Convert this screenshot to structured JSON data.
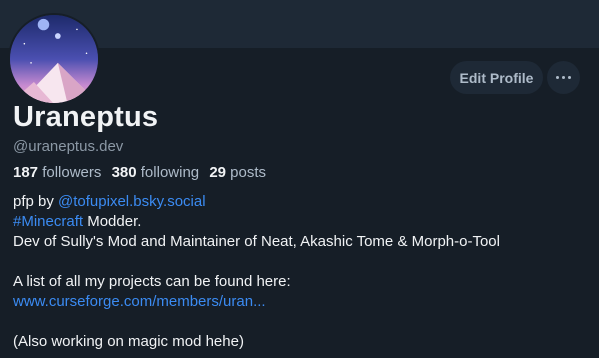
{
  "profile": {
    "display_name": "Uraneptus",
    "handle": "@uraneptus.dev",
    "avatar_icon": "space-landscape-avatar"
  },
  "actions": {
    "edit_label": "Edit Profile",
    "more_icon": "ellipsis-icon"
  },
  "stats": {
    "followers_count": "187",
    "followers_label": "followers",
    "following_count": "380",
    "following_label": "following",
    "posts_count": "29",
    "posts_label": "posts"
  },
  "bio": {
    "line1_prefix": "pfp by ",
    "line1_mention": "@tofupixel.bsky.social",
    "line2_hashtag": "#Minecraft",
    "line2_rest": " Modder.",
    "line3": "Dev of Sully's Mod and Maintainer of Neat, Akashic Tome & Morph-o-Tool",
    "line5": "A list of all my projects can be found here:",
    "line6_link": "www.curseforge.com/members/uran...",
    "line8": "(Also working on magic mod hehe)"
  },
  "colors": {
    "background": "#161e27",
    "banner": "#1e2936",
    "link": "#3b8bf2",
    "muted": "#8b98a5"
  }
}
